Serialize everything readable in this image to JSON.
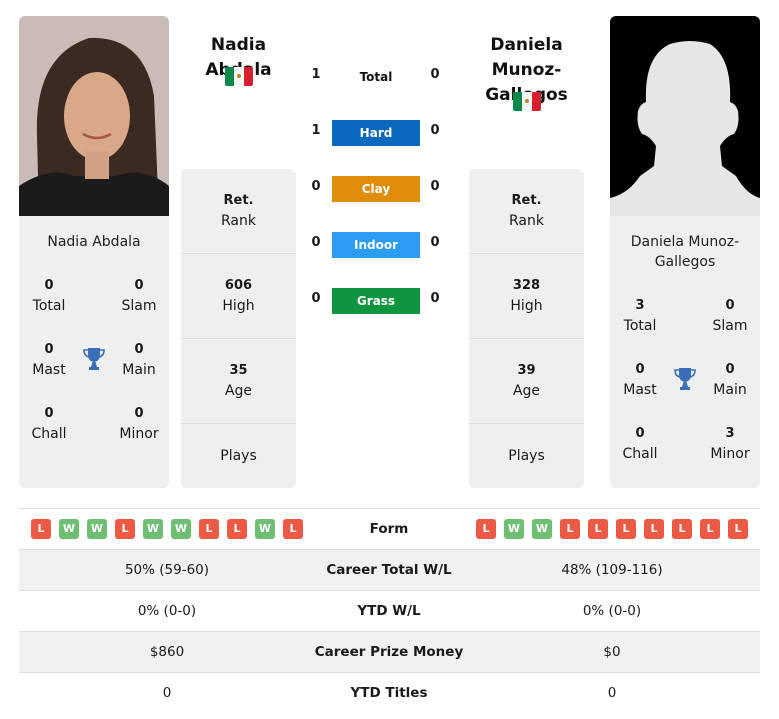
{
  "player1": {
    "name": "Nadia Abdala",
    "country_flag": "mexico-flag",
    "photo": "player-photo",
    "titles": {
      "total": {
        "value": "0",
        "label": "Total"
      },
      "slam": {
        "value": "0",
        "label": "Slam"
      },
      "mast": {
        "value": "0",
        "label": "Mast"
      },
      "main": {
        "value": "0",
        "label": "Main"
      },
      "chall": {
        "value": "0",
        "label": "Chall"
      },
      "minor": {
        "value": "0",
        "label": "Minor"
      }
    },
    "rank": {
      "value": "Ret.",
      "label": "Rank"
    },
    "high": {
      "value": "606",
      "label": "High"
    },
    "age": {
      "value": "35",
      "label": "Age"
    },
    "plays": {
      "label": "Plays"
    },
    "form": [
      "L",
      "W",
      "W",
      "L",
      "W",
      "W",
      "L",
      "L",
      "W",
      "L"
    ],
    "career_wl": "50% (59-60)",
    "ytd_wl": "0% (0-0)",
    "prize_money": "$860",
    "ytd_titles": "0"
  },
  "player2": {
    "name": "Daniela Munoz-Gallegos",
    "name_line1": "Daniela Munoz-",
    "name_line2": "Gallegos",
    "country_flag": "mexico-flag",
    "photo": "silhouette-placeholder",
    "titles": {
      "total": {
        "value": "3",
        "label": "Total"
      },
      "slam": {
        "value": "0",
        "label": "Slam"
      },
      "mast": {
        "value": "0",
        "label": "Mast"
      },
      "main": {
        "value": "0",
        "label": "Main"
      },
      "chall": {
        "value": "0",
        "label": "Chall"
      },
      "minor": {
        "value": "3",
        "label": "Minor"
      }
    },
    "rank": {
      "value": "Ret.",
      "label": "Rank"
    },
    "high": {
      "value": "328",
      "label": "High"
    },
    "age": {
      "value": "39",
      "label": "Age"
    },
    "plays": {
      "label": "Plays"
    },
    "form": [
      "L",
      "W",
      "W",
      "L",
      "L",
      "L",
      "L",
      "L",
      "L",
      "L"
    ],
    "career_wl": "48% (109-116)",
    "ytd_wl": "0% (0-0)",
    "prize_money": "$0",
    "ytd_titles": "0"
  },
  "h2h": {
    "total": {
      "label": "Total",
      "p1": "1",
      "p2": "0"
    },
    "surfaces": [
      {
        "label": "Hard",
        "p1": "1",
        "p2": "0",
        "color": "#0a68bd"
      },
      {
        "label": "Clay",
        "p1": "0",
        "p2": "0",
        "color": "#de8c0a"
      },
      {
        "label": "Indoor",
        "p1": "0",
        "p2": "0",
        "color": "#2b9cf2"
      },
      {
        "label": "Grass",
        "p1": "0",
        "p2": "0",
        "color": "#0f9540"
      }
    ]
  },
  "table": {
    "form_label": "Form",
    "career_wl_label": "Career Total W/L",
    "ytd_wl_label": "YTD W/L",
    "prize_label": "Career Prize Money",
    "ytd_titles_label": "YTD Titles"
  },
  "colors": {
    "loss": "#ea5a44",
    "win": "#6fbf73",
    "trophy": "#3a6fb8",
    "card_bg": "#efefef"
  }
}
